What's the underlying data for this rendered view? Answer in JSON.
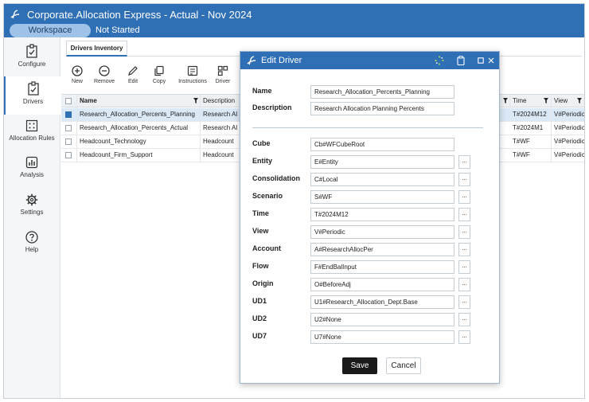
{
  "app": {
    "title": "Corporate.Allocation Express  -  Actual  -  Nov 2024",
    "workspace_label": "Workspace",
    "status": "Not Started",
    "colors": {
      "brand": "#2f6fb5",
      "workspace_pill": "#9fc2e8"
    }
  },
  "nav": {
    "items": [
      {
        "label": "Configure",
        "icon": "configure-icon"
      },
      {
        "label": "Drivers",
        "icon": "drivers-icon",
        "active": true
      },
      {
        "label": "Allocation Rules",
        "icon": "allocation-rules-icon"
      },
      {
        "label": "Analysis",
        "icon": "analysis-icon"
      },
      {
        "label": "Settings",
        "icon": "gear-icon"
      },
      {
        "label": "Help",
        "icon": "help-icon"
      }
    ]
  },
  "tabs": {
    "active": "Drivers Inventory"
  },
  "toolbar": {
    "new": "New",
    "remove": "Remove",
    "edit": "Edit",
    "copy": "Copy",
    "instructions": "Instructions",
    "driver": "Driver"
  },
  "grid": {
    "headers": {
      "name": "Name",
      "description": "Description",
      "time": "Time",
      "view": "View"
    },
    "rows": [
      {
        "name": "Research_Allocation_Percents_Planning",
        "description": "Research Al",
        "time": "T#2024M12",
        "view": "V#Periodic",
        "selected": true
      },
      {
        "name": "Research_Allocation_Percents_Actual",
        "description": "Research Al",
        "time": "T#2024M1",
        "view": "V#Periodic"
      },
      {
        "name": "Headcount_Technology",
        "description": "Headcount",
        "time": "T#WF",
        "view": "V#Periodic"
      },
      {
        "name": "Headcount_Firm_Support",
        "description": "Headcount",
        "time": "T#WF",
        "view": "V#Periodic"
      }
    ]
  },
  "modal": {
    "title": "Edit Driver",
    "name_label": "Name",
    "name_value": "Research_Allocation_Percents_Planning",
    "description_label": "Description",
    "description_value": "Research Allocation Planning Percents",
    "fields": [
      {
        "label": "Cube",
        "value": "Cb#WFCubeRoot",
        "has_picker": false
      },
      {
        "label": "Entity",
        "value": "E#Entity",
        "has_picker": true
      },
      {
        "label": "Consolidation",
        "value": "C#Local",
        "has_picker": true
      },
      {
        "label": "Scenario",
        "value": "S#WF",
        "has_picker": true
      },
      {
        "label": "Time",
        "value": "T#2024M12",
        "has_picker": true
      },
      {
        "label": "View",
        "value": "V#Periodic",
        "has_picker": true
      },
      {
        "label": "Account",
        "value": "A#ResearchAllocPer",
        "has_picker": true
      },
      {
        "label": "Flow",
        "value": "F#EndBalInput",
        "has_picker": true
      },
      {
        "label": "Origin",
        "value": "O#BeforeAdj",
        "has_picker": true
      },
      {
        "label": "UD1",
        "value": "U1#Research_Allocation_Dept.Base",
        "has_picker": true
      },
      {
        "label": "UD2",
        "value": "U2#None",
        "has_picker": true
      },
      {
        "label": "UD7",
        "value": "U7#None",
        "has_picker": true
      }
    ],
    "picker_label": "...",
    "save": "Save",
    "cancel": "Cancel"
  }
}
